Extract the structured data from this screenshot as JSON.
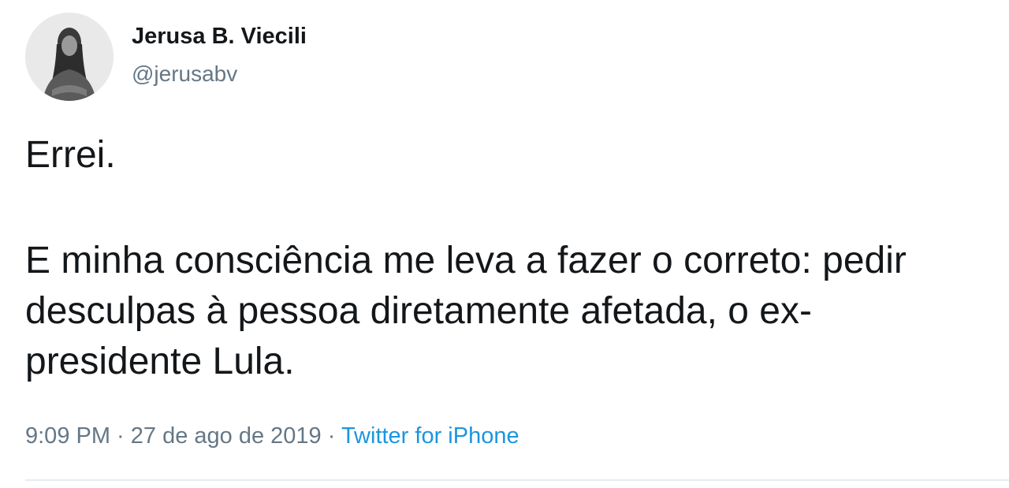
{
  "author": {
    "name": "Jerusa B. Viecili",
    "handle": "@jerusabv",
    "avatar_icon": "profile-photo-icon"
  },
  "tweet": {
    "paragraph_1": "Errei.",
    "paragraph_2": "E minha consciência me leva a fazer o correto: pedir\ndesculpas à pessoa diretamente afetada, o ex-\npresidente Lula."
  },
  "meta": {
    "time": "9:09 PM",
    "separator": " · ",
    "date": "27 de ago de 2019",
    "source": "Twitter for iPhone"
  },
  "colors": {
    "text": "#14171a",
    "secondary": "#657786",
    "link": "#1b95e0",
    "divider": "#e6ecf0"
  }
}
